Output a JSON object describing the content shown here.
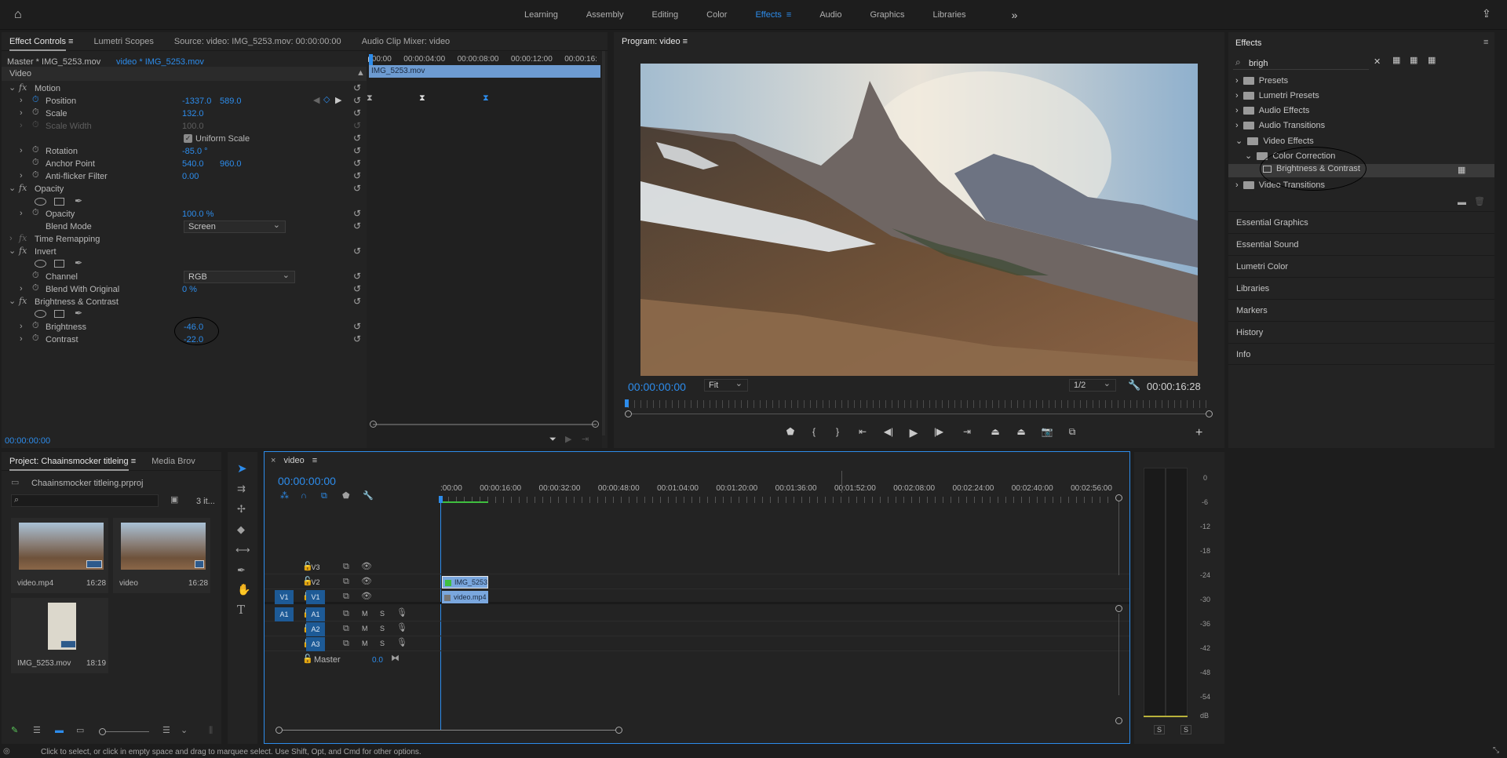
{
  "workspaces": {
    "items": [
      "Learning",
      "Assembly",
      "Editing",
      "Color",
      "Effects",
      "Audio",
      "Graphics",
      "Libraries"
    ],
    "active": "Effects",
    "more_symbol": "»"
  },
  "effect_controls": {
    "tabs": [
      "Effect Controls",
      "Lumetri Scopes",
      "Source: video: IMG_5253.mov: 00:00:00:00",
      "Audio Clip Mixer: video"
    ],
    "master_label": "Master * IMG_5253.mov",
    "clip_label": "video * IMG_5253.mov",
    "section": "Video",
    "timeline_clip": "IMG_5253.mov",
    "ruler": [
      ":00:00",
      "00:00:04:00",
      "00:00:08:00",
      "00:00:12:00",
      "00:00:16:"
    ],
    "timecode": "00:00:00:00",
    "motion": {
      "name": "Motion",
      "position_label": "Position",
      "position_x": "-1337.0",
      "position_y": "589.0",
      "scale_label": "Scale",
      "scale": "132.0",
      "scale_width_label": "Scale Width",
      "scale_width": "100.0",
      "uniform_scale_label": "Uniform Scale",
      "rotation_label": "Rotation",
      "rotation": "-85.0 °",
      "anchor_label": "Anchor Point",
      "anchor_x": "540.0",
      "anchor_y": "960.0",
      "flicker_label": "Anti-flicker Filter",
      "flicker": "0.00"
    },
    "opacity": {
      "name": "Opacity",
      "opacity_label": "Opacity",
      "opacity": "100.0 %",
      "blend_label": "Blend Mode",
      "blend": "Screen"
    },
    "time_remapping": "Time Remapping",
    "invert": {
      "name": "Invert",
      "channel_label": "Channel",
      "channel": "RGB",
      "blend_label": "Blend With Original",
      "blend": "0 %"
    },
    "brightness_contrast": {
      "name": "Brightness & Contrast",
      "brightness_label": "Brightness",
      "brightness": "-46.0",
      "contrast_label": "Contrast",
      "contrast": "-22.0"
    }
  },
  "program": {
    "title": "Program: video",
    "timecode": "00:00:00:00",
    "fit": "Fit",
    "resolution": "1/2",
    "duration": "00:00:16:28"
  },
  "effects_panel": {
    "title": "Effects",
    "search_value": "brigh",
    "tree": [
      "Presets",
      "Lumetri Presets",
      "Audio Effects",
      "Audio Transitions",
      "Video Effects",
      "Color Correction",
      "Brightness & Contrast",
      "Video Transitions"
    ],
    "sections": [
      "Essential Graphics",
      "Essential Sound",
      "Lumetri Color",
      "Libraries",
      "Markers",
      "History",
      "Info"
    ]
  },
  "project": {
    "tabs": [
      "Project: Chaainsmocker titleing",
      "Media Brov"
    ],
    "file": "Chaainsmocker titleing.prproj",
    "count": "3 it...",
    "items": [
      {
        "name": "video.mp4",
        "duration": "16:28"
      },
      {
        "name": "video",
        "duration": "16:28"
      },
      {
        "name": "IMG_5253.mov",
        "duration": "18:19"
      }
    ]
  },
  "timeline": {
    "tab": "video",
    "timecode": "00:00:00:00",
    "ruler": [
      ":00:00",
      "00:00:16:00",
      "00:00:32:00",
      "00:00:48:00",
      "00:01:04:00",
      "00:01:20:00",
      "00:01:36:00",
      "00:01:52:00",
      "00:02:08:00",
      "00:02:24:00",
      "00:02:40:00",
      "00:02:56:00"
    ],
    "tracks": {
      "v3": "V3",
      "v2": "V2",
      "v1": "V1",
      "a1": "A1",
      "a2": "A2",
      "a3": "A3",
      "m": "M",
      "s": "S",
      "master": "Master",
      "master_val": "0.0"
    },
    "clip_v2": "IMG_5253.",
    "clip_v1": "video.mp4"
  },
  "meter": {
    "labels": [
      "0",
      "-6",
      "-12",
      "-18",
      "-24",
      "-30",
      "-36",
      "-42",
      "-48",
      "-54",
      "dB"
    ],
    "solo": "S"
  },
  "status_bar": "Click to select, or click in empty space and drag to marquee select. Use Shift, Opt, and Cmd for other options."
}
